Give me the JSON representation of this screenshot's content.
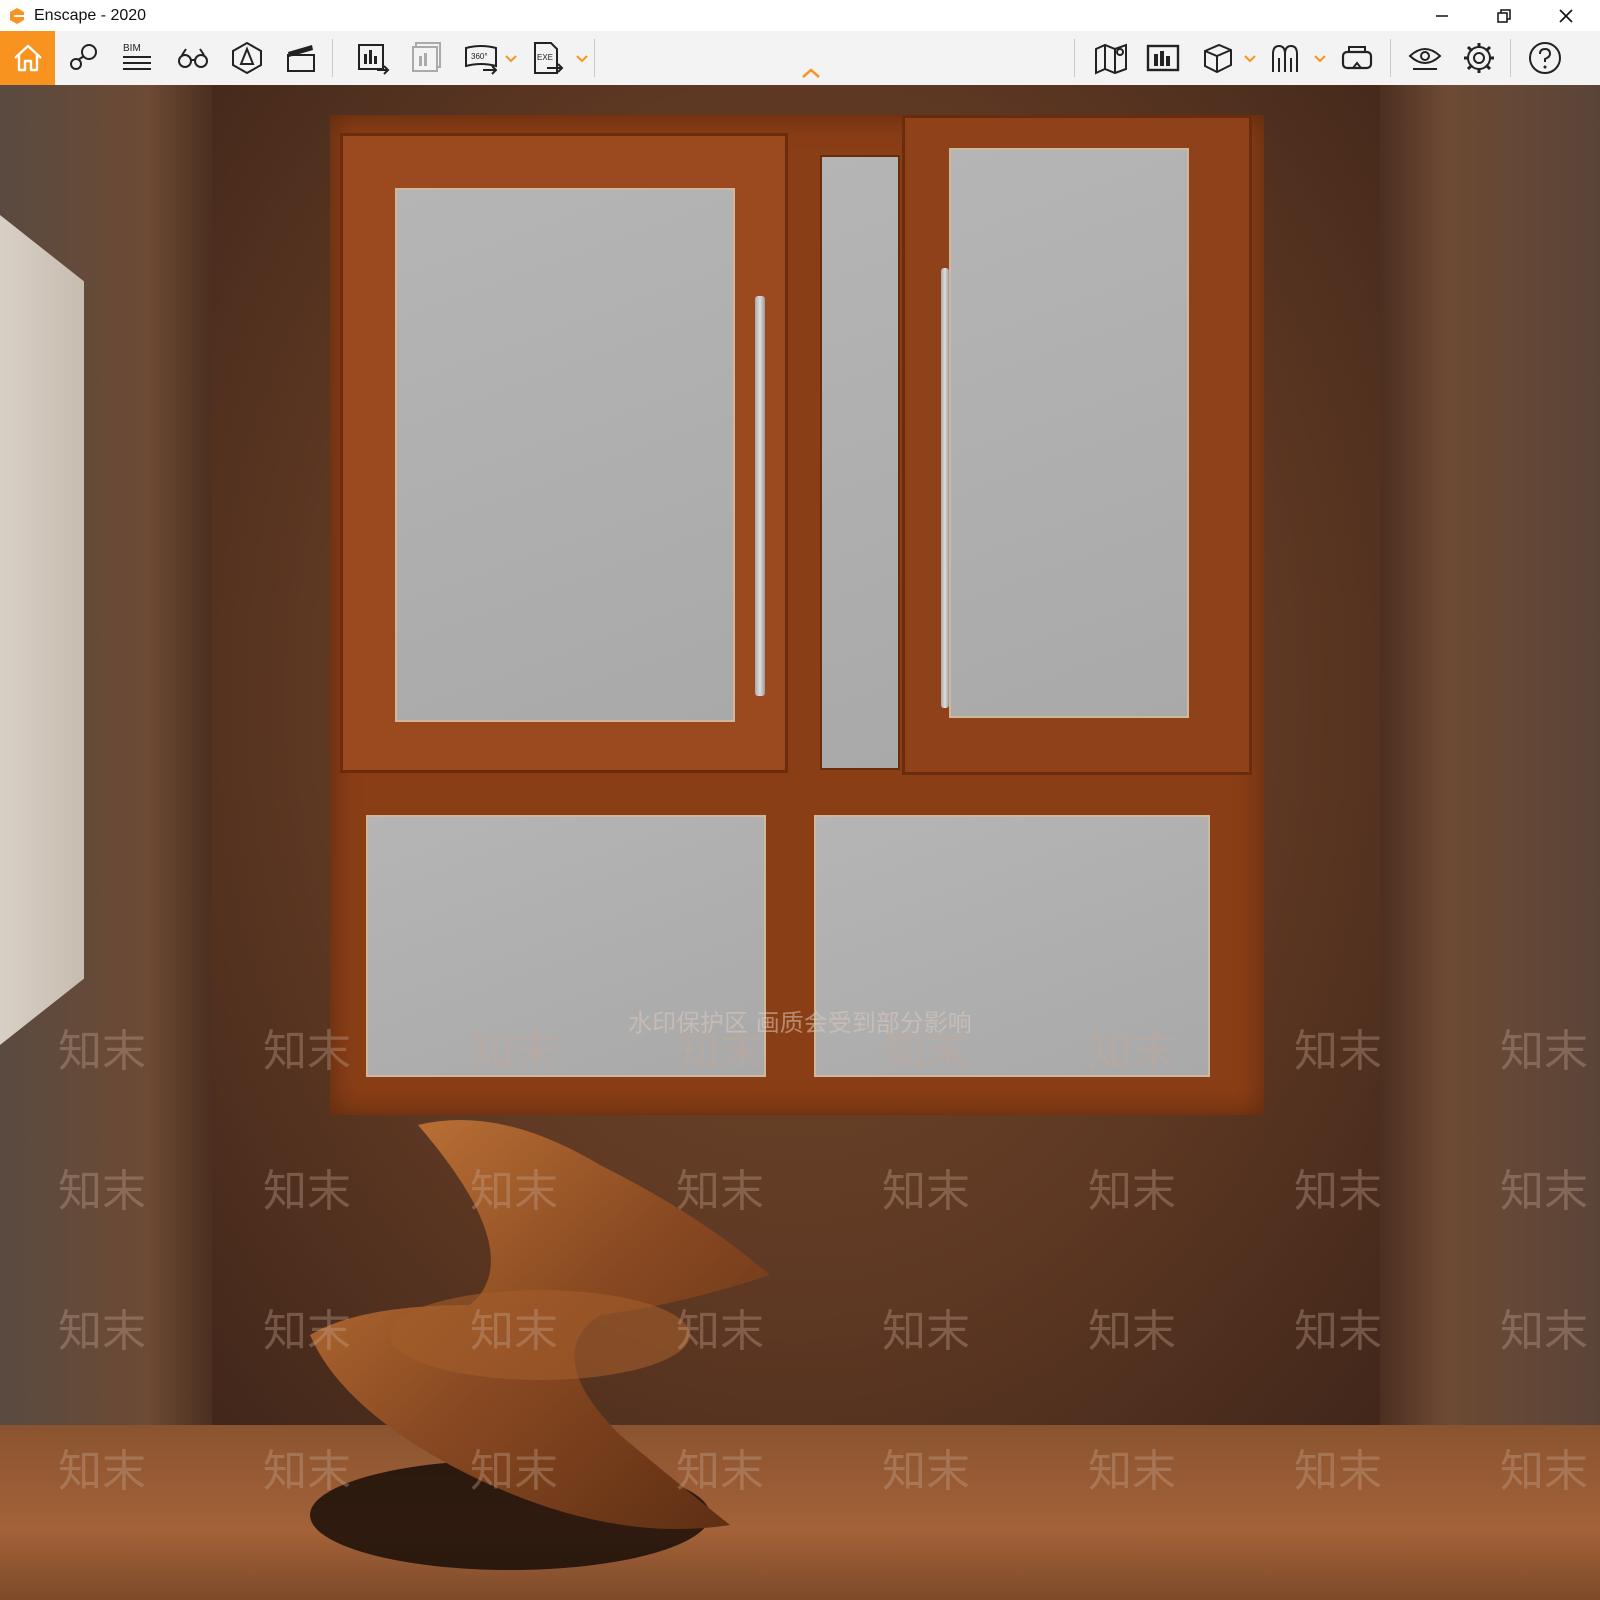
{
  "window": {
    "title": "Enscape - 2020",
    "logo_icon": "enscape-logo-icon",
    "controls": [
      "minimize",
      "restore",
      "close"
    ]
  },
  "toolbar": {
    "accent_color": "#f7931e",
    "left_buttons": [
      {
        "name": "home",
        "icon": "home-icon",
        "active": true
      },
      {
        "name": "views",
        "icon": "location-views-icon"
      },
      {
        "name": "bim",
        "icon": "bim-icon",
        "label": "BIM"
      },
      {
        "name": "navigation",
        "icon": "binoculars-icon"
      },
      {
        "name": "atmosphere",
        "icon": "atmosphere-icon"
      },
      {
        "name": "video-editor",
        "icon": "clapperboard-icon"
      },
      {
        "name": "render-image",
        "icon": "render-image-icon"
      },
      {
        "name": "batch-render",
        "icon": "batch-render-icon",
        "disabled": true
      },
      {
        "name": "panorama",
        "icon": "panorama-360-icon",
        "label": "360°",
        "dropdown": true
      },
      {
        "name": "export-exe",
        "icon": "export-exe-icon",
        "label": "EXE",
        "dropdown": true
      }
    ],
    "right_buttons": [
      {
        "name": "map",
        "icon": "map-icon"
      },
      {
        "name": "asset-library",
        "icon": "asset-library-icon"
      },
      {
        "name": "cube-view",
        "icon": "cube-icon",
        "dropdown": true
      },
      {
        "name": "people",
        "icon": "people-icon",
        "dropdown": true
      },
      {
        "name": "vr-headset",
        "icon": "vr-headset-icon"
      },
      {
        "name": "visual-settings",
        "icon": "eye-icon"
      },
      {
        "name": "settings",
        "icon": "gear-icon"
      },
      {
        "name": "help",
        "icon": "help-icon"
      }
    ]
  },
  "watermark": {
    "banner": "水印保护区   画质会受到部分影响",
    "repeat_text": "知末"
  }
}
